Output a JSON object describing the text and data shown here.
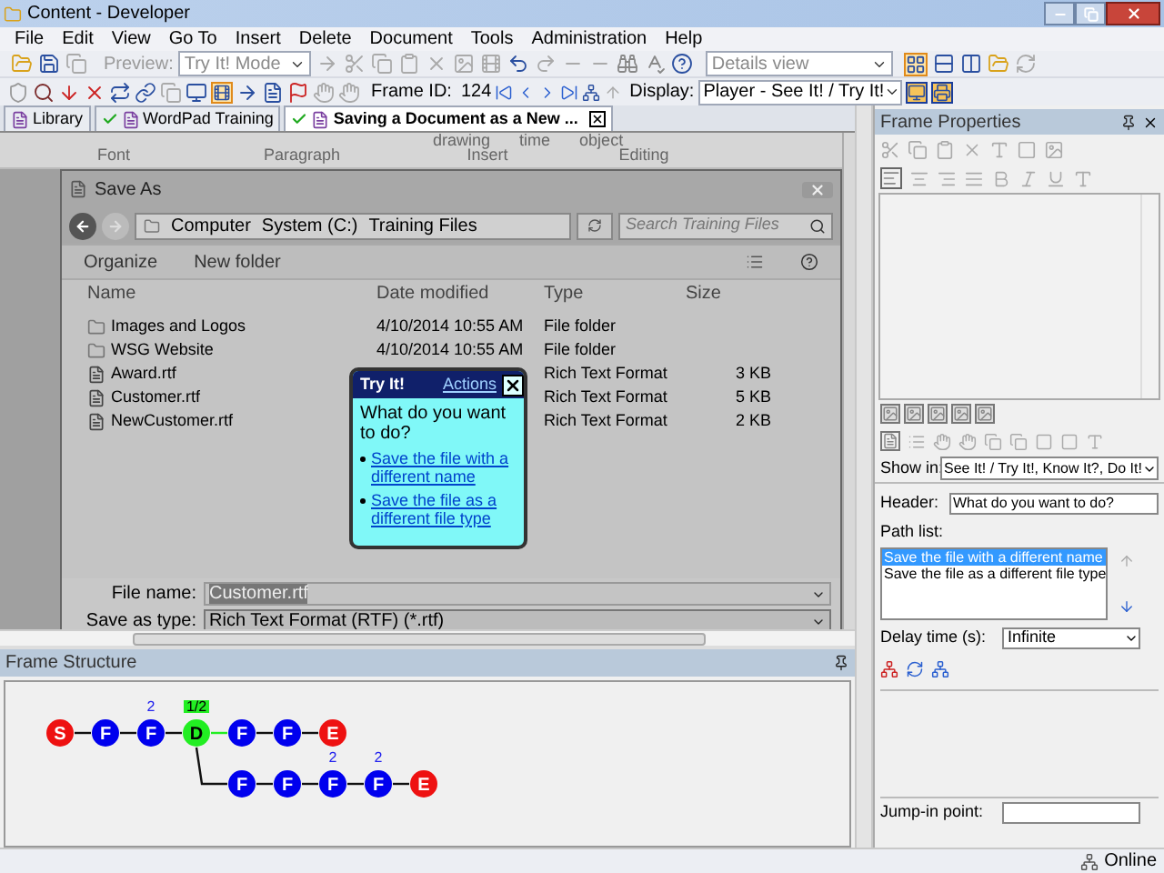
{
  "window": {
    "title": "Content - Developer"
  },
  "menu": [
    {
      "label": "File"
    },
    {
      "label": "Edit"
    },
    {
      "label": "View"
    },
    {
      "label": "Go To"
    },
    {
      "label": "Insert"
    },
    {
      "label": "Delete"
    },
    {
      "label": "Document"
    },
    {
      "label": "Tools"
    },
    {
      "label": "Administration"
    },
    {
      "label": "Help"
    }
  ],
  "toolbar": {
    "preview_label": "Preview:",
    "mode_select": "Try It! Mode",
    "view_select": "Details view",
    "frame_id_label": "Frame ID:",
    "frame_id": "124",
    "display_label": "Display:",
    "display_select": "Player - See It! / Try It!"
  },
  "tabs": [
    {
      "label": "Library",
      "selected": false,
      "checkmark": false
    },
    {
      "label": "WordPad Training",
      "selected": false,
      "checkmark": true
    },
    {
      "label": "Saving a Document as a New ...",
      "selected": true,
      "checkmark": true
    }
  ],
  "editor": {
    "ribbon_top": [
      "drawing",
      "time",
      "object"
    ],
    "ribbon_groups": [
      "Font",
      "Paragraph",
      "Insert",
      "Editing"
    ],
    "dialog": {
      "title": "Save As",
      "breadcrumb": [
        "Computer",
        "System (C:)",
        "Training Files"
      ],
      "search_placeholder": "Search Training Files",
      "commands": [
        "Organize",
        "New folder"
      ],
      "columns": [
        "Name",
        "Date modified",
        "Type",
        "Size"
      ],
      "rows": [
        {
          "kind": "folder",
          "name": "Images and Logos",
          "date": "4/10/2014 10:55 AM",
          "type": "File folder"
        },
        {
          "kind": "folder",
          "name": "WSG Website",
          "date": "4/10/2014 10:55 AM",
          "type": "File folder"
        },
        {
          "kind": "file",
          "name": "Award.rtf",
          "type": "Rich Text Format",
          "size": "3 KB"
        },
        {
          "kind": "file",
          "name": "Customer.rtf",
          "type": "Rich Text Format",
          "size": "5 KB"
        },
        {
          "kind": "file",
          "name": "NewCustomer.rtf",
          "type": "Rich Text Format",
          "size": "2 KB"
        }
      ],
      "file_name_label": "File name:",
      "file_name": "Customer.rtf",
      "save_type_label": "Save as type:",
      "save_type": "Rich Text Format (RTF) (*.rtf)"
    },
    "bubble": {
      "title": "Try It!",
      "actions": "Actions",
      "question": "What do you want to do?",
      "links": [
        "Save the file with a different name",
        "Save the file as a different file type"
      ]
    }
  },
  "frame_structure": {
    "title": "Frame Structure",
    "rows": [
      [
        {
          "kind": "start",
          "letter": "S"
        },
        {
          "kind": "frame",
          "letter": "F"
        },
        {
          "kind": "frame",
          "letter": "F",
          "note": "2"
        },
        {
          "kind": "decision",
          "letter": "D",
          "note": "1/2"
        },
        {
          "kind": "frame",
          "letter": "F"
        },
        {
          "kind": "frame",
          "letter": "F"
        },
        {
          "kind": "end",
          "letter": "E"
        }
      ],
      [
        "",
        "",
        "",
        "",
        {
          "kind": "frame",
          "letter": "F"
        },
        {
          "kind": "frame",
          "letter": "F"
        },
        {
          "kind": "frame",
          "letter": "F",
          "note": "2"
        },
        {
          "kind": "frame",
          "letter": "F",
          "note": "2"
        },
        {
          "kind": "end",
          "letter": "E"
        }
      ]
    ]
  },
  "frame_properties": {
    "title": "Frame Properties",
    "show_in_label": "Show in:",
    "show_in": "See It! / Try It!, Know It?, Do It!",
    "header_label": "Header:",
    "header": "What do you want to do?",
    "path_list_label": "Path list:",
    "paths": [
      {
        "label": "Save the file with a different name",
        "selected": true
      },
      {
        "label": "Save the file as a different file type",
        "selected": false
      }
    ],
    "delay_label": "Delay time (s):",
    "delay": "Infinite",
    "jump_in_label": "Jump-in point:"
  },
  "status_bar": {
    "text": "Online"
  }
}
